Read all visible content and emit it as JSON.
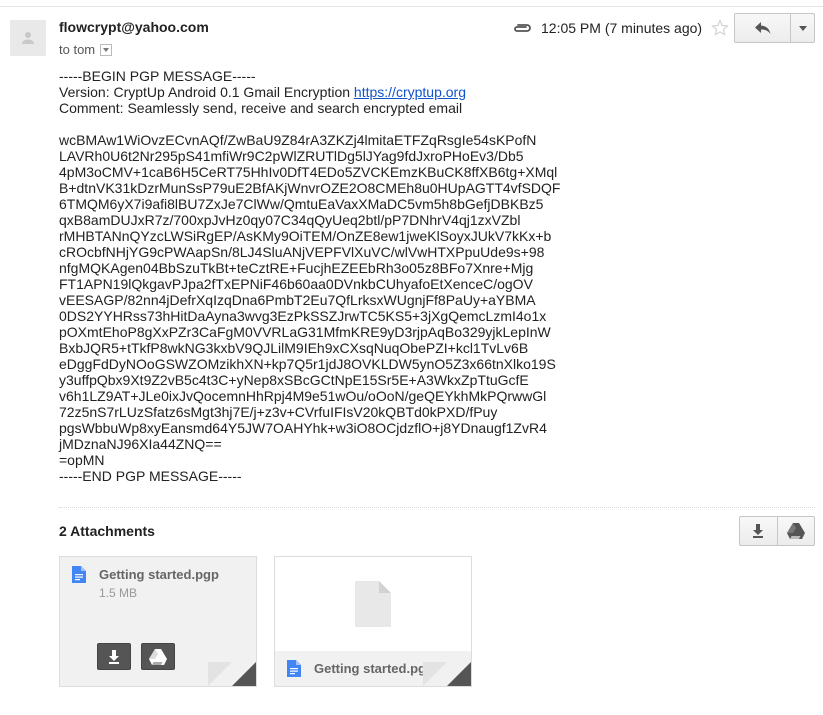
{
  "header": {
    "sender": "flowcrypt@yahoo.com",
    "recipient": "to tom",
    "time": "12:05 PM (7 minutes ago)"
  },
  "message": {
    "begin": "-----BEGIN PGP MESSAGE-----",
    "version_prefix": "Version: CryptUp Android 0.1 Gmail Encryption ",
    "version_link": "https://cryptup.org",
    "comment": "Comment: Seamlessly send, receive and search encrypted email",
    "body": "wcBMAw1WiOvzECvnAQf/ZwBaU9Z84rA3ZKZj4lmitaETFZqRsgIe54sKPofN\nLAVRh0U6t2Nr295pS41mfiWr9C2pWlZRUTlDg5lJYag9fdJxroPHoEv3/Db5\n4pM3oCMV+1caB6H5CeRT75HhIv0DfT4EDo5ZVCKEmzKBuCK8ffXB6tg+XMql\nB+dtnVK31kDzrMunSsP79uE2BfAKjWnvrOZE2O8CMEh8u0HUpAGTT4vfSDQF\n6TMQM6yX7i9afi8lBU7ZxJe7ClWw/QmtuEaVaxXMaDC5vm5h8bGefjDBKBz5\nqxB8amDUJxR7z/700xpJvHz0qy07C34qQyUeq2btl/pP7DNhrV4qj1zxVZbl\nrMHBTANnQYzcLWSiRgEP/AsKMy9OiTEM/OnZE8ew1jweKlSoyxJUkV7kKx+b\ncROcbfNHjYG9cPWAapSn/8LJ4SluANjVEPFVlXuVC/wlVwHTXPpuUde9s+98\nnfgMQKAgen04BbSzuTkBt+teCztRE+FucjhEZEEbRh3o05z8BFo7Xnre+Mjg\nFT1APN19lQkgavPJpa2fTxEPNiF46b60aa0DVnkbCUhyafoEtXenceC/ogOV\nvEESAGP/82nn4jDefrXqIzqDna6PmbT2Eu7QfLrksxWUgnjFf8PaUy+aYBMA\n0DS2YYHRss73hHitDaAyna3wvg3EzPkSSZJrwTC5KS5+3jXgQemcLzmI4o1x\npOXmtEhoP8gXxPZr3CaFgM0VVRLaG31MfmKRE9yD3rjpAqBo329yjkLepInW\nBxbJQR5+tTkfP8wkNG3kxbV9QJLilM9IEh9xCXsqNuqObePZI+kcl1TvLv6B\neDggFdDyNOoGSWZOMzikhXN+kp7Q5r1jdJ8OVKLDW5ynO5Z3x66tnXlko19S\ny3uffpQbx9Xt9Z2vB5c4t3C+yNep8xSBcGCtNpE15Sr5E+A3WkxZpTtuGcfE\nv6h1LZ9AT+JLe0ixJvQocemnHhRpj4M9e51wOu/oOoN/geQEYkhMkPQrwwGl\n72z5nS7rLUzSfatz6sMgt3hj7E/j+z3v+CVrfuIFIsV20kQBTd0kPXD/fPuy\npgsWbbuWp8xyEansmd64Y5JW7OAHYhk+w3iO8OCjdzflO+j8YDnaugf1ZvR4\njMDznaNJ96XIa44ZNQ==\n=opMN",
    "end": "-----END PGP MESSAGE-----"
  },
  "attachments": {
    "title": "2 Attachments",
    "items": [
      {
        "name": "Getting started.pgp",
        "size": "1.5 MB"
      },
      {
        "name": "Getting started.pgp"
      }
    ]
  },
  "colors": {
    "link": "#1155cc",
    "file_icon": "#4285f4",
    "dark_button": "#555555"
  },
  "icons": {
    "avatar": "person-icon",
    "attachment": "paperclip-icon",
    "star": "star-icon",
    "reply": "reply-icon",
    "more": "chevron-down-icon",
    "download": "download-icon",
    "drive": "drive-icon",
    "file": "file-icon"
  }
}
